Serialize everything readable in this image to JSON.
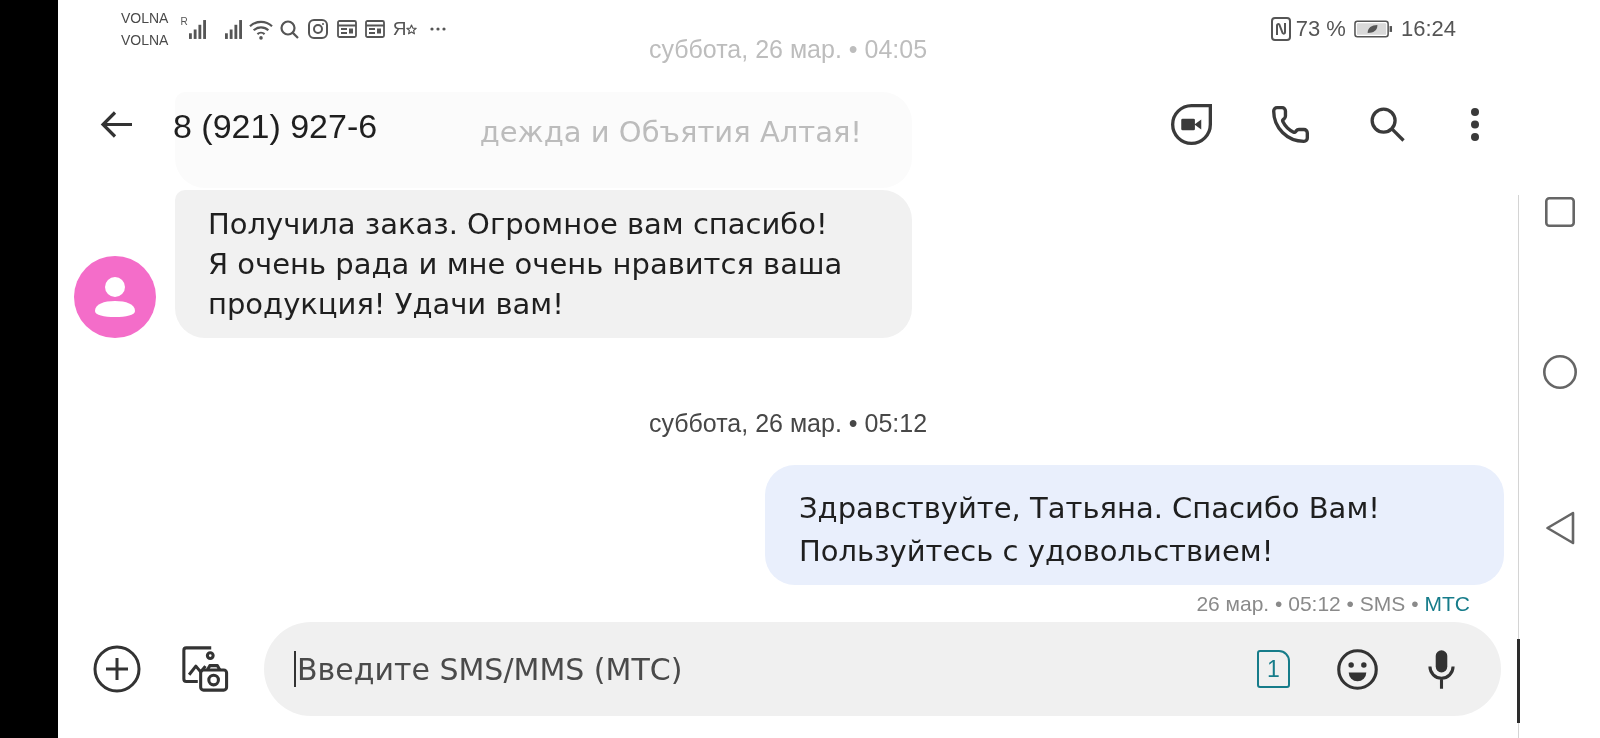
{
  "status_bar": {
    "operators": [
      "VOLNA",
      "VOLNA"
    ],
    "roaming_mark": "R",
    "app_letter": "Я",
    "battery_percent": "73 %",
    "time": "16:24"
  },
  "header": {
    "title": "8 (921) 927-6"
  },
  "conversation": {
    "items": [
      {
        "kind": "date",
        "text": "суббота, 26 мар. • 04:05",
        "dimmed": true
      },
      {
        "kind": "received",
        "text": "дежда и Объятия Алтая!",
        "dimmed": true,
        "avatar": false
      },
      {
        "kind": "received",
        "text": "Получила заказ. Огромное вам спасибо!\nЯ очень рада и мне очень нравится ваша\nпродукция! Удачи вам!",
        "dimmed": false,
        "avatar": true
      },
      {
        "kind": "date",
        "text": "суббота, 26 мар. • 05:12",
        "dimmed": false
      },
      {
        "kind": "sent",
        "text": "Здравствуйте, Татьяна. Спасибо Вам!\nПользуйтесь с удовольствием!",
        "dimmed": false,
        "status": "26 мар. • 05:12 • SMS •",
        "carrier": "МТС"
      }
    ]
  },
  "composer": {
    "placeholder": "Введите SMS/MMS (МТС)",
    "sim": "1"
  }
}
